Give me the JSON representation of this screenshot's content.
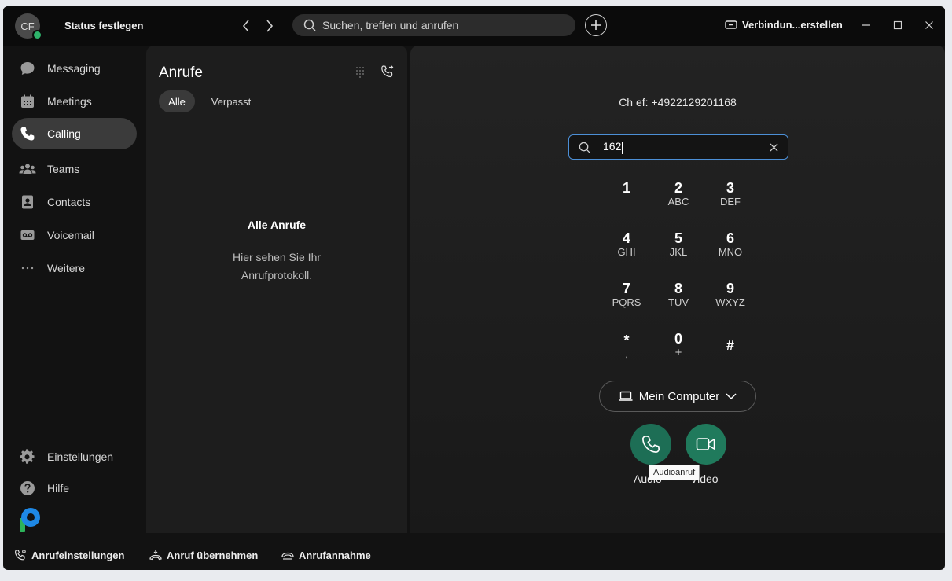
{
  "titlebar": {
    "avatar_initials": "CF",
    "status": "Status festlegen",
    "search_placeholder": "Suchen, treffen und anrufen",
    "connect_label": "Verbindun...erstellen"
  },
  "sidebar": {
    "items": [
      {
        "label": "Messaging",
        "icon": "chat-bubble-icon"
      },
      {
        "label": "Meetings",
        "icon": "calendar-icon"
      },
      {
        "label": "Calling",
        "icon": "phone-icon",
        "active": true
      },
      {
        "label": "Teams",
        "icon": "people-icon"
      },
      {
        "label": "Contacts",
        "icon": "contacts-icon"
      },
      {
        "label": "Voicemail",
        "icon": "voicemail-icon"
      },
      {
        "label": "Weitere",
        "icon": "more-icon"
      }
    ],
    "bottom": [
      {
        "label": "Einstellungen",
        "icon": "gear-icon"
      },
      {
        "label": "Hilfe",
        "icon": "help-icon"
      }
    ]
  },
  "calls": {
    "title": "Anrufe",
    "filters": [
      "Alle",
      "Verpasst"
    ],
    "empty_title": "Alle Anrufe",
    "empty_text": "Hier sehen Sie Ihr Anrufprotokoll."
  },
  "dialer": {
    "caller_id": "Ch ef: +4922129201168",
    "input_value": "162",
    "keys": [
      {
        "d": "1",
        "l": ""
      },
      {
        "d": "2",
        "l": "ABC"
      },
      {
        "d": "3",
        "l": "DEF"
      },
      {
        "d": "4",
        "l": "GHI"
      },
      {
        "d": "5",
        "l": "JKL"
      },
      {
        "d": "6",
        "l": "MNO"
      },
      {
        "d": "7",
        "l": "PQRS"
      },
      {
        "d": "8",
        "l": "TUV"
      },
      {
        "d": "9",
        "l": "WXYZ"
      },
      {
        "d": "*",
        "l": ","
      },
      {
        "d": "0",
        "l": "+"
      },
      {
        "d": "#",
        "l": ""
      }
    ],
    "device": "Mein Computer",
    "audio_label": "Audio",
    "video_label": "Video",
    "tooltip": "Audioanruf"
  },
  "footer": {
    "call_settings": "Anrufeinstellungen",
    "call_pickup": "Anruf übernehmen",
    "call_answer": "Anrufannahme"
  },
  "colors": {
    "accent_green": "#1d6e55",
    "focus_blue": "#4c8fd6",
    "presence_green": "#2eb36b"
  }
}
